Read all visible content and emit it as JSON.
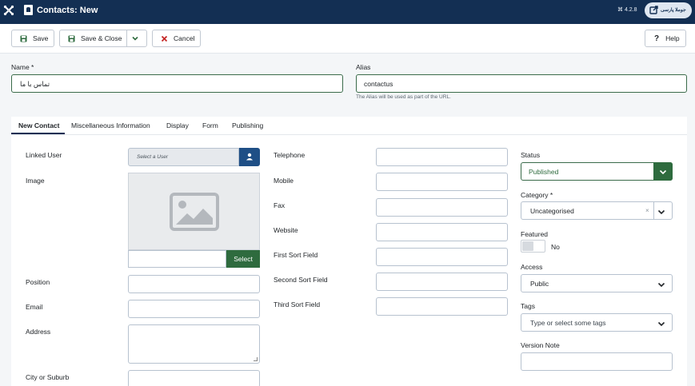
{
  "header": {
    "title": "Contacts: New",
    "version": "⌘ 4.2.8",
    "site_button": "جوملا پارسی"
  },
  "toolbar": {
    "save": "Save",
    "save_close": "Save & Close",
    "cancel": "Cancel",
    "help": "Help"
  },
  "form": {
    "name_label": "Name *",
    "name_value": "تماس با ما",
    "alias_label": "Alias",
    "alias_value": "contactus",
    "alias_hint": "The Alias will be used as part of the URL."
  },
  "tabs": [
    "New Contact",
    "Miscellaneous Information",
    "Display",
    "Form",
    "Publishing"
  ],
  "left_col": {
    "linked_user": "Linked User",
    "select_user_placeholder": "Select a User",
    "image": "Image",
    "image_select": "Select",
    "position": "Position",
    "email": "Email",
    "address": "Address",
    "city": "City or Suburb"
  },
  "mid_col": {
    "telephone": "Telephone",
    "mobile": "Mobile",
    "fax": "Fax",
    "website": "Website",
    "first_sort": "First Sort Field",
    "second_sort": "Second Sort Field",
    "third_sort": "Third Sort Field"
  },
  "right_col": {
    "status_label": "Status",
    "status_value": "Published",
    "category_label": "Category *",
    "category_value": "Uncategorised",
    "featured_label": "Featured",
    "featured_value": "No",
    "access_label": "Access",
    "access_value": "Public",
    "tags_label": "Tags",
    "tags_placeholder": "Type or select some tags",
    "version_note_label": "Version Note"
  },
  "colors": {
    "header_bg": "#132f53",
    "success_green": "#2e6b3e",
    "primary_blue": "#1f4f86"
  }
}
